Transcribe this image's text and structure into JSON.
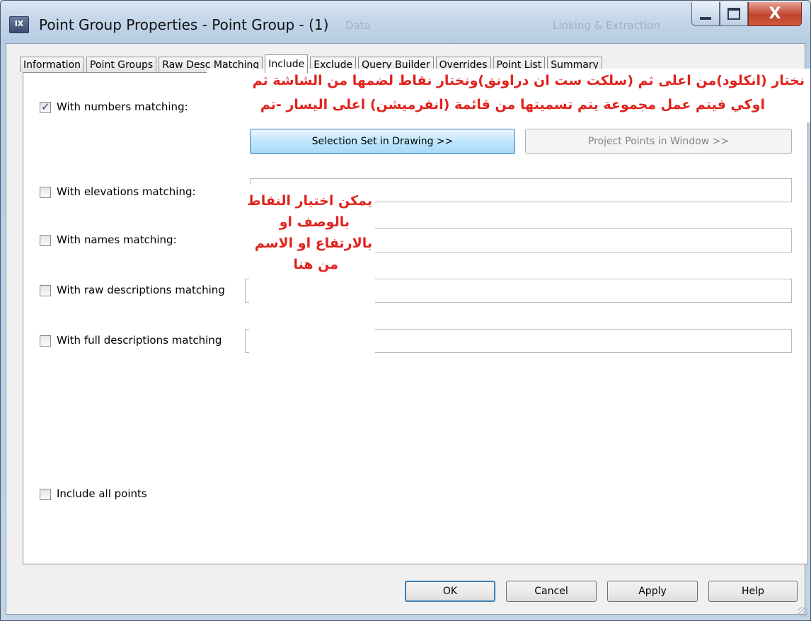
{
  "window": {
    "title": "Point Group Properties - Point Group - (1)",
    "icon_label": "IX",
    "background_titles": [
      "Data",
      "Linking & Extraction"
    ],
    "minimize_icon": "minimize-icon",
    "maximize_icon": "maximize-icon",
    "close_icon": "close-icon",
    "close_glyph": "X"
  },
  "tabs": [
    "Information",
    "Point Groups",
    "Raw Desc Matching",
    "Include",
    "Exclude",
    "Query Builder",
    "Overrides",
    "Point List",
    "Summary"
  ],
  "active_tab": "Include",
  "include": {
    "numbers": {
      "label": "With numbers matching:",
      "checked": true,
      "value": ""
    },
    "selection_button": "Selection Set in Drawing >>",
    "project_points_button": "Project Points in Window >>",
    "elevations": {
      "label": "With elevations matching:",
      "checked": false,
      "value": ""
    },
    "names": {
      "label": "With names matching:",
      "checked": false,
      "value": ""
    },
    "raw_descriptions": {
      "label": "With raw descriptions matching",
      "checked": false,
      "value": ""
    },
    "full_descriptions": {
      "label": "With full descriptions matching",
      "checked": false,
      "value": ""
    },
    "include_all": {
      "label": "Include all points",
      "checked": false
    }
  },
  "annotations": {
    "note_top": [
      "نختار (انكلود)من اعلى ثم (سلكت ست ان دراونق)ونختار نقاط لضمها من الشاشة ثم",
      "اوكي فيتم عمل مجموعة يتم تسميتها من قائمة (انفرميشن) اعلى اليسار -تم"
    ],
    "note_side": [
      "يمكن اختيار النقاط",
      "بالوصف او",
      "بالارتفاع او الاسم",
      "من هنا"
    ],
    "color": "#e0231d"
  },
  "footer": {
    "ok": "OK",
    "cancel": "Cancel",
    "apply": "Apply",
    "help": "Help"
  }
}
